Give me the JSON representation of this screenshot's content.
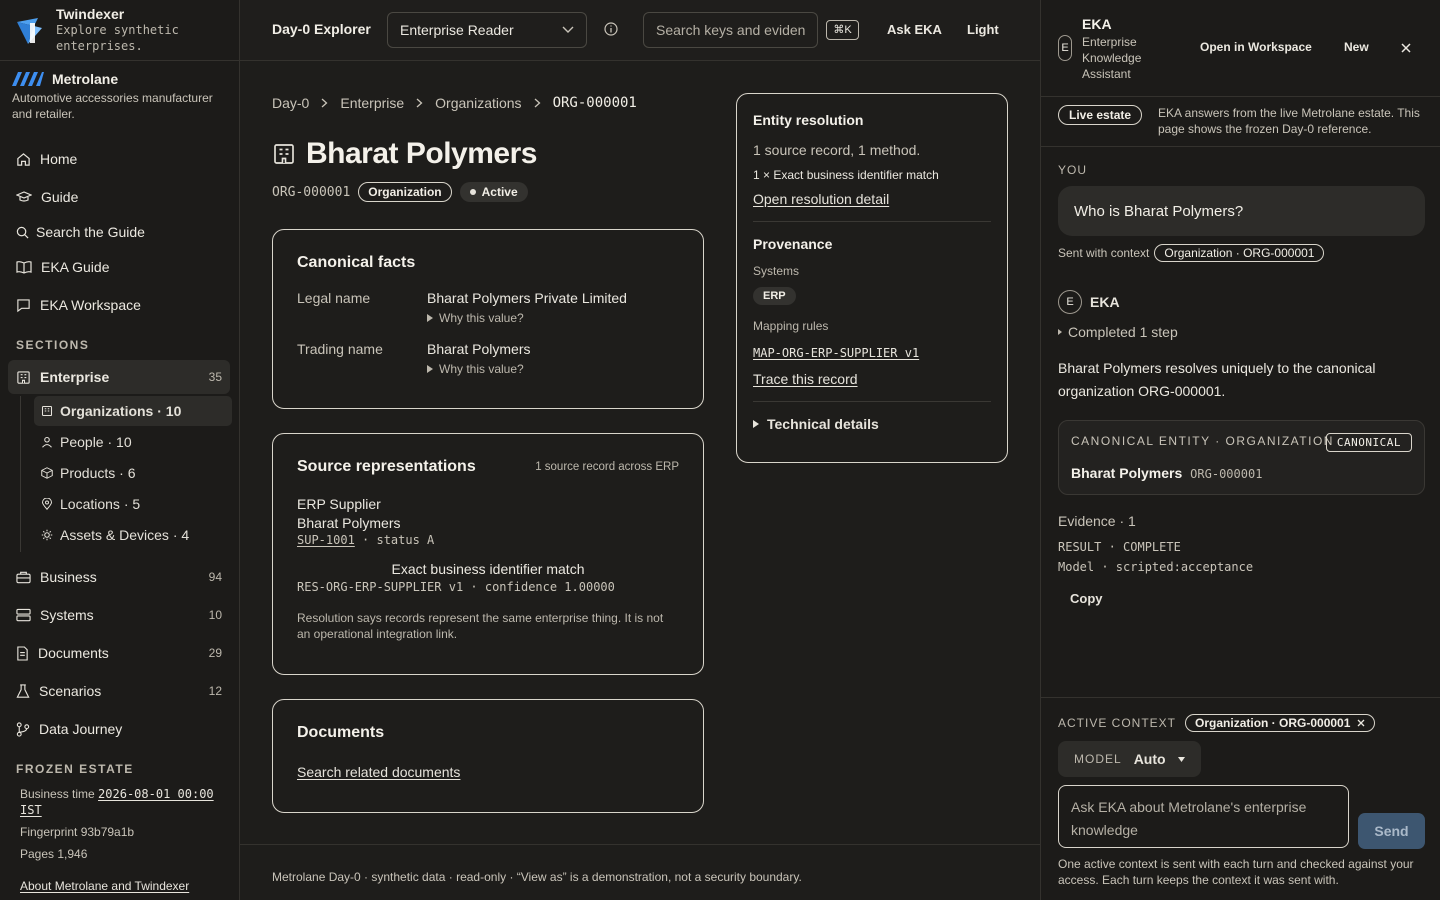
{
  "brand": {
    "name": "Twindexer",
    "tagline": "Explore synthetic enterprises."
  },
  "org": {
    "name": "Metrolane",
    "description": "Automotive accessories manufacturer and retailer."
  },
  "nav": {
    "home": "Home",
    "guide": "Guide",
    "search_guide": "Search the Guide",
    "eka_guide": "EKA Guide",
    "eka_workspace": "EKA Workspace"
  },
  "sections_label": "SECTIONS",
  "sections": {
    "enterprise": {
      "label": "Enterprise",
      "count": "35"
    },
    "business": {
      "label": "Business",
      "count": "94"
    },
    "systems": {
      "label": "Systems",
      "count": "10"
    },
    "documents": {
      "label": "Documents",
      "count": "29"
    },
    "scenarios": {
      "label": "Scenarios",
      "count": "12"
    },
    "journey": {
      "label": "Data Journey"
    }
  },
  "subnav": {
    "organizations": "Organizations · 10",
    "people": "People · 10",
    "products": "Products · 6",
    "locations": "Locations · 5",
    "assets": "Assets & Devices · 4"
  },
  "frozen": {
    "label": "FROZEN ESTATE",
    "business_time_label": "Business time",
    "business_time": "2026-08-01 00:00 IST",
    "fingerprint": "Fingerprint 93b79a1b",
    "pages": "Pages 1,946",
    "about": "About Metrolane and Twindexer"
  },
  "header": {
    "title": "Day-0 Explorer",
    "view_select": "Enterprise Reader",
    "search_placeholder": "Search keys and evidence",
    "kbd": "⌘K",
    "ask": "Ask EKA",
    "theme": "Light"
  },
  "breadcrumb": [
    "Day-0",
    "Enterprise",
    "Organizations",
    "ORG-000001"
  ],
  "entity": {
    "title": "Bharat Polymers",
    "id": "ORG-000001",
    "type": "Organization",
    "status": "Active"
  },
  "canonical": {
    "heading": "Canonical facts",
    "legal_label": "Legal name",
    "legal_value": "Bharat Polymers Private Limited",
    "trading_label": "Trading name",
    "trading_value": "Bharat Polymers",
    "why": "Why this value?"
  },
  "sources": {
    "heading": "Source representations",
    "summary": "1 source record across ERP",
    "system": "ERP Supplier",
    "name": "Bharat Polymers",
    "record": "SUP-1001",
    "record_status": " · status A",
    "match": "Exact business identifier match",
    "rule": "RES-ORG-ERP-SUPPLIER v1 · confidence 1.00000",
    "note": "Resolution says records represent the same enterprise thing. It is not an operational integration link."
  },
  "documents": {
    "heading": "Documents",
    "link": "Search related documents"
  },
  "footer": "Metrolane Day-0 · synthetic data · read-only · “View as” is a demonstration, not a security boundary.",
  "resolution": {
    "heading": "Entity resolution",
    "summary": "1 source record, 1 method.",
    "method": "1 × Exact business identifier match",
    "link": "Open resolution detail"
  },
  "provenance": {
    "heading": "Provenance",
    "systems_label": "Systems",
    "system": "ERP",
    "mapping_label": "Mapping rules",
    "mapping": "MAP-ORG-ERP-SUPPLIER v1",
    "trace": "Trace this record",
    "technical": "Technical details"
  },
  "eka": {
    "avatar": "E",
    "title": "EKA",
    "subtitle": "Enterprise Knowledge Assistant",
    "open_workspace": "Open in Workspace",
    "new": "New",
    "live_pill": "Live estate",
    "live_text": "EKA answers from the live Metrolane estate. This page shows the frozen Day-0 reference.",
    "you": "YOU",
    "question": "Who is Bharat Polymers?",
    "sent_with": "Sent with context",
    "context": "Organization · ORG-000001",
    "assistant": "EKA",
    "completed": "Completed 1 step",
    "answer": "Bharat Polymers resolves uniquely to the canonical organization ORG-000001.",
    "canon_label": "CANONICAL ENTITY · ORGANIZATION",
    "canon_tag": "CANONICAL",
    "canon_name": "Bharat Polymers",
    "canon_id": "ORG-000001",
    "evidence": "Evidence · 1",
    "result": "RESULT · COMPLETE",
    "model_line": "Model · scripted:acceptance",
    "copy": "Copy",
    "active_context_label": "ACTIVE CONTEXT",
    "active_context": "Organization · ORG-000001",
    "model_label": "MODEL",
    "model_value": "Auto",
    "ask_placeholder": "Ask EKA about Metrolane's enterprise knowledge",
    "send": "Send",
    "note": "One active context is sent with each turn and checked against your access. Each turn keeps the context it was sent with."
  }
}
